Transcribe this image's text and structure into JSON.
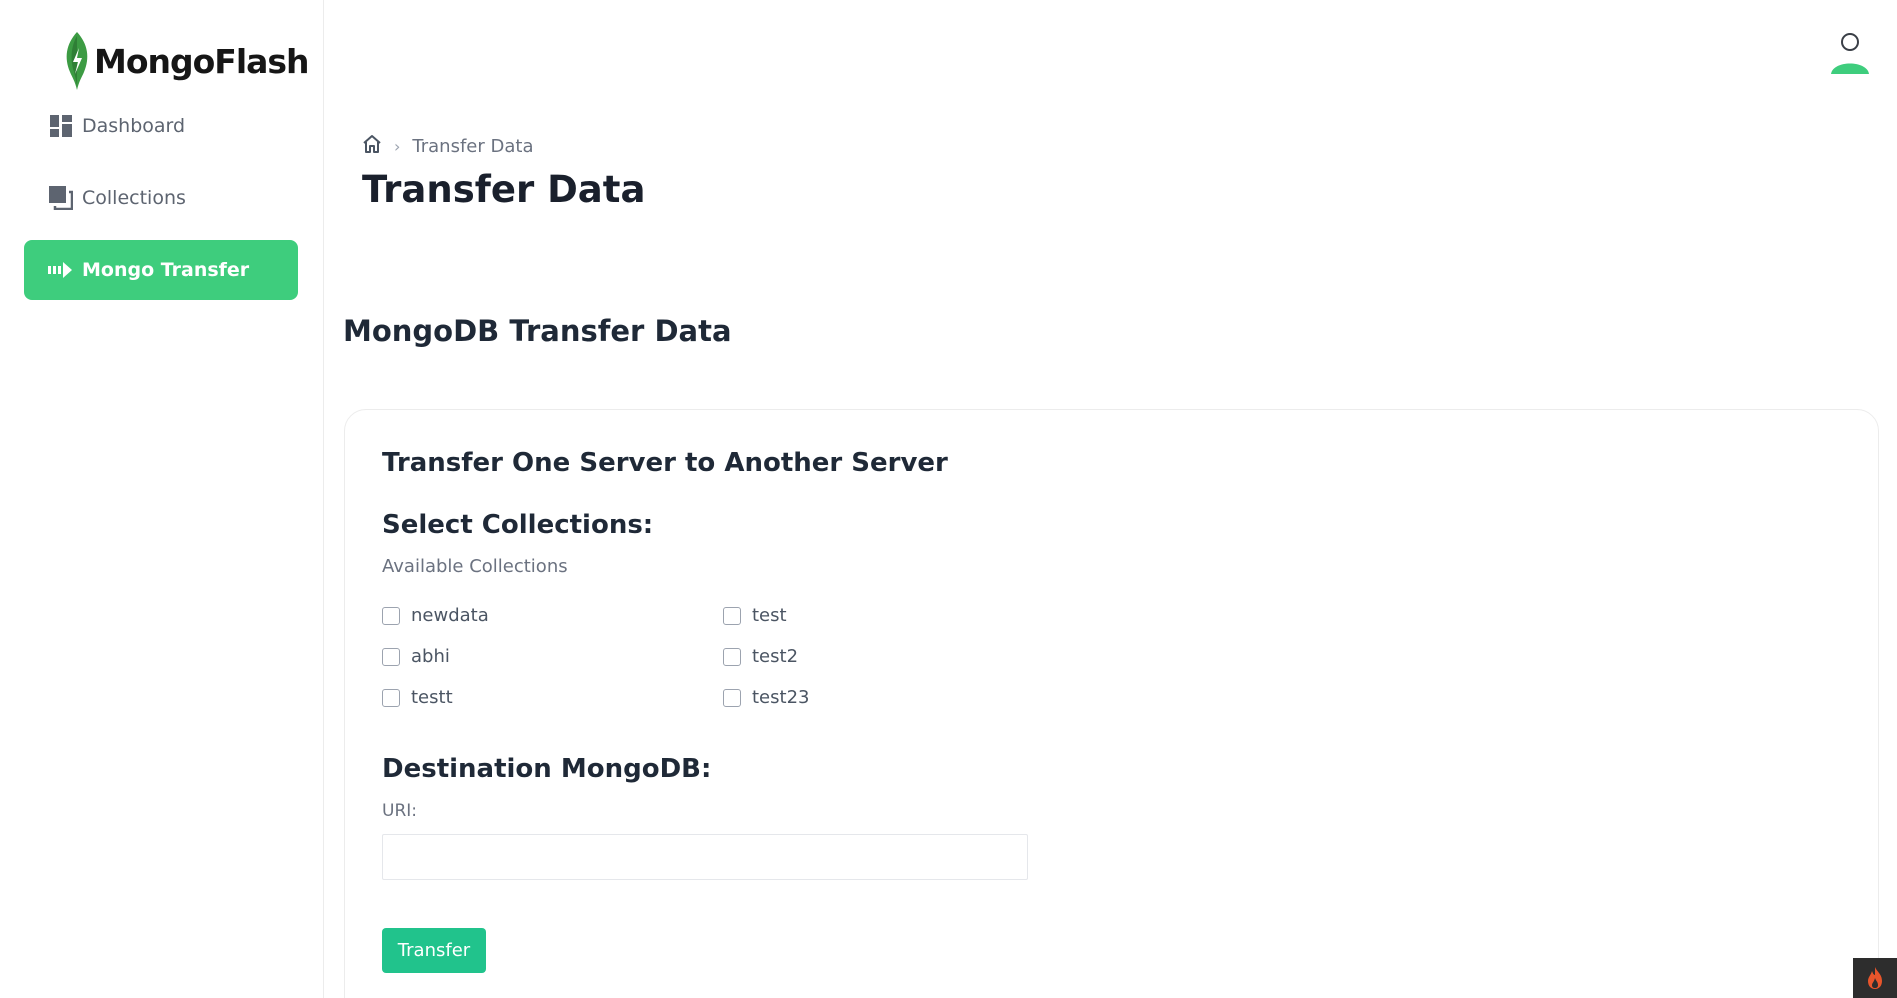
{
  "app": {
    "name": "MongoFlash"
  },
  "sidebar": {
    "items": [
      {
        "label": "Dashboard",
        "icon": "dashboard-icon",
        "active": false
      },
      {
        "label": "Collections",
        "icon": "collections-icon",
        "active": false
      },
      {
        "label": "Mongo Transfer",
        "icon": "transfer-icon",
        "active": true
      }
    ]
  },
  "breadcrumb": {
    "home_icon": "home-icon",
    "current": "Transfer Data"
  },
  "page": {
    "title": "Transfer Data",
    "section_title": "MongoDB Transfer Data"
  },
  "card": {
    "title": "Transfer One Server to Another Server",
    "select_heading": "Select Collections:",
    "available_label": "Available Collections",
    "collections": [
      "newdata",
      "test",
      "abhi",
      "test2",
      "testt",
      "test23"
    ],
    "destination_heading": "Destination MongoDB:",
    "uri_label": "URI:",
    "uri_value": "",
    "transfer_button": "Transfer"
  },
  "colors": {
    "accent": "#3ecd7d",
    "button": "#21c38c",
    "logo_leaf": "#3c9b43"
  }
}
